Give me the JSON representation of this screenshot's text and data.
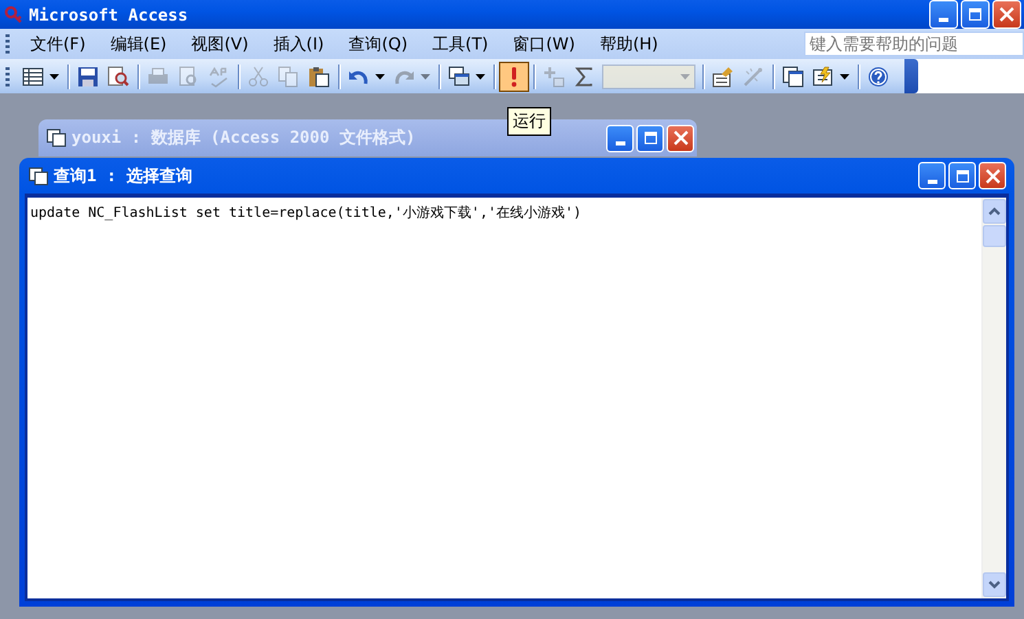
{
  "window": {
    "title": "Microsoft Access"
  },
  "menu": [
    {
      "label": "文件(F)"
    },
    {
      "label": "编辑(E)"
    },
    {
      "label": "视图(V)"
    },
    {
      "label": "插入(I)"
    },
    {
      "label": "查询(Q)"
    },
    {
      "label": "工具(T)"
    },
    {
      "label": "窗口(W)"
    },
    {
      "label": "帮助(H)"
    }
  ],
  "help_box": {
    "placeholder": "键入需要帮助的问题"
  },
  "toolbar": [
    {
      "items": [
        {
          "kind": "table",
          "disabled": false,
          "pressed": false,
          "dropdown": true
        }
      ]
    },
    {
      "items": [
        {
          "kind": "save",
          "disabled": false,
          "pressed": false,
          "dropdown": false
        },
        {
          "kind": "search",
          "disabled": false,
          "pressed": false,
          "dropdown": false
        }
      ]
    },
    {
      "items": [
        {
          "kind": "print",
          "disabled": true,
          "pressed": false,
          "dropdown": false
        },
        {
          "kind": "preview",
          "disabled": true,
          "pressed": false,
          "dropdown": false
        },
        {
          "kind": "spelling",
          "disabled": true,
          "pressed": false,
          "dropdown": false
        }
      ]
    },
    {
      "items": [
        {
          "kind": "cut",
          "disabled": true,
          "pressed": false,
          "dropdown": false
        },
        {
          "kind": "copy",
          "disabled": true,
          "pressed": false,
          "dropdown": false
        },
        {
          "kind": "paste",
          "disabled": false,
          "pressed": false,
          "dropdown": false
        }
      ]
    },
    {
      "items": [
        {
          "kind": "undo",
          "disabled": false,
          "pressed": false,
          "dropdown": true
        },
        {
          "kind": "redo",
          "disabled": true,
          "pressed": false,
          "dropdown": true
        }
      ]
    },
    {
      "items": [
        {
          "kind": "query-type",
          "disabled": false,
          "pressed": false,
          "dropdown": true
        }
      ]
    },
    {
      "items": [
        {
          "kind": "run",
          "disabled": false,
          "pressed": true,
          "dropdown": false
        }
      ]
    },
    {
      "items": [
        {
          "kind": "show-table",
          "disabled": true,
          "pressed": false,
          "dropdown": false
        },
        {
          "kind": "totals",
          "disabled": false,
          "pressed": false,
          "dropdown": false
        },
        {
          "kind": "combo",
          "disabled": true,
          "pressed": false,
          "dropdown": true
        }
      ]
    },
    {
      "items": [
        {
          "kind": "properties",
          "disabled": false,
          "pressed": false,
          "dropdown": false
        },
        {
          "kind": "builder",
          "disabled": true,
          "pressed": false,
          "dropdown": false
        }
      ]
    },
    {
      "items": [
        {
          "kind": "database-window",
          "disabled": false,
          "pressed": false,
          "dropdown": false
        },
        {
          "kind": "new-object",
          "disabled": false,
          "pressed": false,
          "dropdown": true
        }
      ]
    },
    {
      "items": [
        {
          "kind": "help",
          "disabled": false,
          "pressed": false,
          "dropdown": false
        }
      ]
    }
  ],
  "tooltip": {
    "text": "运行"
  },
  "database_window": {
    "title": "youxi : 数据库 (Access 2000 文件格式)",
    "active": false
  },
  "query_window": {
    "title": "查询1 : 选择查询",
    "active": true,
    "sql": "update NC_FlashList set title=replace(title,'小游戏下载','在线小游戏')"
  }
}
